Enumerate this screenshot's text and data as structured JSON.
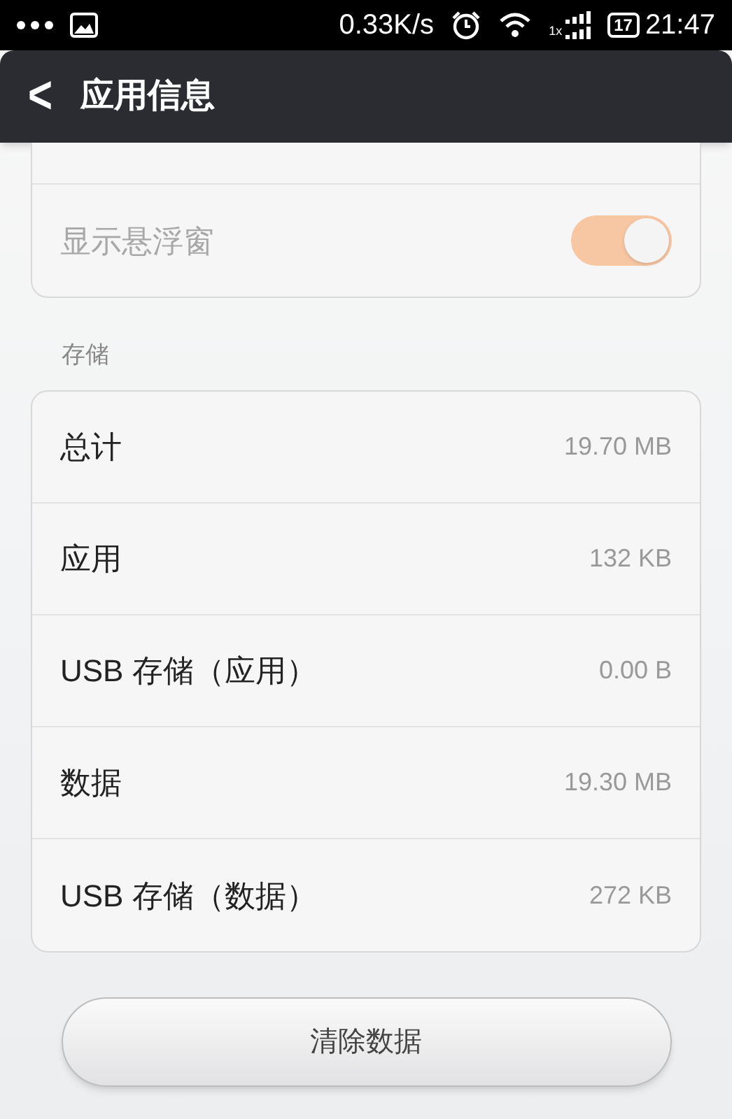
{
  "status_bar": {
    "speed": "0.33K/s",
    "network_type": "1x",
    "battery": "17",
    "time": "21:47"
  },
  "header": {
    "back": "<",
    "title": "应用信息"
  },
  "settings_rows": [
    {
      "label": "显示悬浮窗",
      "on": true,
      "disabled": true
    }
  ],
  "storage": {
    "heading": "存储",
    "rows": [
      {
        "label": "总计",
        "value": "19.70 MB"
      },
      {
        "label": "应用",
        "value": "132 KB"
      },
      {
        "label": "USB 存储（应用）",
        "value": "0.00 B"
      },
      {
        "label": "数据",
        "value": "19.30 MB"
      },
      {
        "label": "USB 存储（数据）",
        "value": "272 KB"
      }
    ]
  },
  "button": "清除数据"
}
